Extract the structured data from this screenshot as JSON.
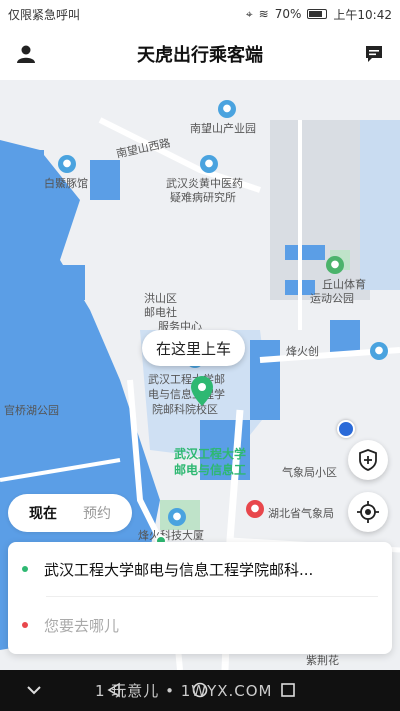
{
  "status_bar": {
    "carrier": "仅限紧急呼叫",
    "battery": "70%",
    "time": "上午10:42"
  },
  "header": {
    "title": "天虎出行乘客端",
    "user_icon": "user-icon",
    "message_icon": "message-icon"
  },
  "map": {
    "labels": {
      "nanwangshan_park": "南望山产业园",
      "nanwangshan_road": "南望山西路",
      "baijitun": "白鱀豚馆",
      "yanhuang_1": "武汉炎黄中医药",
      "yanhuang_2": "疑难病研究所",
      "hongshan_1": "洪山区",
      "hongshan_2": "邮电社",
      "hongshan_3": "服务中心",
      "wuhan_eng_1": "武汉工程大学邮",
      "wuhan_eng_2": "电与信息工程学",
      "wuhan_eng_3": "院邮科院校区",
      "qiushan_1": "丘山体育",
      "qiushan_2": "运动公园",
      "fenghuo": "烽火创",
      "guanqiao": "官桥湖公园",
      "green_1": "武汉工程大学",
      "green_2": "邮电与信息工",
      "qixiang_xiaoqu": "气象局小区",
      "hubei_qixiang": "湖北省气象局",
      "fenghuo_tech": "烽火科技大厦",
      "zijing": "紫荆花"
    },
    "pickup_bubble": "在这里上车"
  },
  "mode_toggle": {
    "now": "现在",
    "reserve": "预约"
  },
  "address": {
    "origin": "武汉工程大学邮电与信息工程学院邮科...",
    "destination_placeholder": "您要去哪儿",
    "origin_color": "#2eb872",
    "destination_color": "#e8474c"
  },
  "nav_bar": {
    "watermark": "1 玩意儿 • 1WYX.COM"
  }
}
